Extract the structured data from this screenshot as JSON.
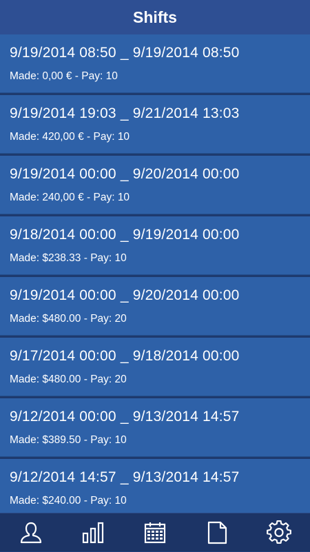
{
  "header": {
    "title": "Shifts"
  },
  "shifts": [
    {
      "range": "9/19/2014 08:50 _ 9/19/2014 08:50",
      "info": "Made: 0,00 € - Pay: 10"
    },
    {
      "range": "9/19/2014 19:03 _ 9/21/2014 13:03",
      "info": "Made: 420,00 € - Pay: 10"
    },
    {
      "range": "9/19/2014 00:00 _ 9/20/2014 00:00",
      "info": "Made: 240,00 € - Pay: 10"
    },
    {
      "range": "9/18/2014 00:00 _ 9/19/2014 00:00",
      "info": "Made: $238.33 - Pay: 10"
    },
    {
      "range": "9/19/2014 00:00 _ 9/20/2014 00:00",
      "info": "Made: $480.00 - Pay: 20"
    },
    {
      "range": "9/17/2014 00:00 _ 9/18/2014 00:00",
      "info": "Made: $480.00 - Pay: 20"
    },
    {
      "range": "9/12/2014 00:00 _ 9/13/2014 14:57",
      "info": "Made: $389.50 - Pay: 10"
    },
    {
      "range": "9/12/2014 14:57 _ 9/13/2014 14:57",
      "info": "Made: $240.00 - Pay: 10"
    }
  ],
  "tabbar": {
    "icons": [
      "profile-icon",
      "bar-chart-icon",
      "calendar-icon",
      "document-icon",
      "gear-icon"
    ],
    "icon_color": "#ffffff"
  },
  "colors": {
    "header_bg": "#2e4f93",
    "row_bg": "#2e61a8",
    "tabbar_bg": "#1c3466"
  }
}
